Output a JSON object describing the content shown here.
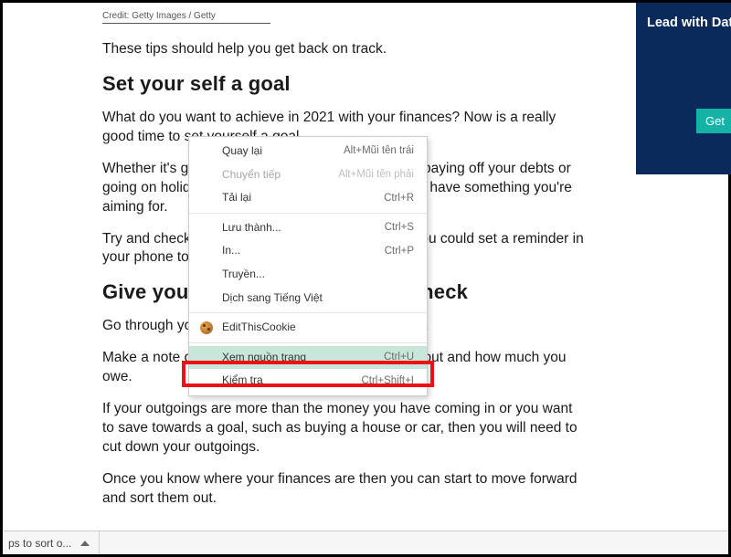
{
  "article": {
    "credit": "Credit: Getty Images / Getty",
    "p1": "These tips should help you get back on track.",
    "h1": "Set your self a goal",
    "p2": "What do you want to achieve in 2021 with your finances? Now is a really good time to set yourself a goal.",
    "p3": "Whether it's getting a deposit together for a house, paying off your debts or going on holiday - it will make it easier for you if you have something you're aiming for.",
    "p4": "Try and check in on your goal regularly - perhaps you could set a reminder in your phone to see where you are at.",
    "h2": "Give yourself a financial health check",
    "p5": "Go through your finances and see where you are at.",
    "p6": "Make a note of the money you have coming in and out and how much you owe.",
    "p7": "If your outgoings are more than the money you have coming in or you want to save towards a goal, such as buying a house or car, then you will need to cut down your outgoings.",
    "p8": "Once you know where your finances are then you can start to move forward and sort them out."
  },
  "ad": {
    "title": "Lead with Data",
    "button": "Get"
  },
  "context_menu": {
    "items": [
      {
        "label": "Quay lại",
        "shortcut": "Alt+Mũi tên trái",
        "disabled": false
      },
      {
        "label": "Chuyển tiếp",
        "shortcut": "Alt+Mũi tên phải",
        "disabled": true
      },
      {
        "label": "Tải lại",
        "shortcut": "Ctrl+R",
        "disabled": false
      }
    ],
    "items2": [
      {
        "label": "Lưu thành...",
        "shortcut": "Ctrl+S"
      },
      {
        "label": "In...",
        "shortcut": "Ctrl+P"
      },
      {
        "label": "Truyền..."
      },
      {
        "label": "Dịch sang Tiếng Việt"
      }
    ],
    "items3": [
      {
        "label": "EditThisCookie",
        "icon": "cookie"
      }
    ],
    "items4": [
      {
        "label": "Xem nguồn trang",
        "shortcut": "Ctrl+U",
        "highlighted": true
      },
      {
        "label": "Kiểm tra",
        "shortcut": "Ctrl+Shift+I"
      }
    ]
  },
  "download_bar": {
    "filename": "ps to sort o..."
  }
}
